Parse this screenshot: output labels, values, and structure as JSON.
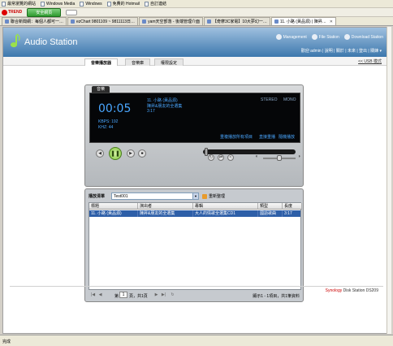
{
  "favorites": [
    {
      "label": "最常瀏覽的網站"
    },
    {
      "label": "Windows Media"
    },
    {
      "label": "Windows"
    },
    {
      "label": "免費的 Hotmail"
    },
    {
      "label": "自訂連結"
    }
  ],
  "trend": {
    "logo": "TREND",
    "safe_label": "安全網頁"
  },
  "tabs": [
    {
      "label": "聯合新聞網：每個人都可一…",
      "active": false
    },
    {
      "label": "ezChart 9801109 ~ 9811113日…",
      "active": false
    },
    {
      "label": "yam天空部落 - 後端管理介面",
      "active": false
    },
    {
      "label": "【奇摩3C家電】10大夢幻一…",
      "active": false
    },
    {
      "label": "11. 小路 (黃品源) | 陳昇…",
      "active": true
    }
  ],
  "status_bar": "完成",
  "header": {
    "title": "Audio Station",
    "links": {
      "management": "Management",
      "file_station": "File Station",
      "download_station": "Download Station"
    }
  },
  "subnav": {
    "tabs": [
      "音樂播放器",
      "音樂庫",
      "權限設定"
    ],
    "user_line": "歡迎 admin | 說明 | 關於 | 未來 | 登出 | 關練 ▾",
    "usb_link": "<< USB 模式"
  },
  "player": {
    "tab_label": "音樂",
    "time": "00:05",
    "kbps": "KBPS: 192",
    "khz": "KHZ: 44",
    "track_title": "11. 小路 (黃品源)",
    "track_album": "陳昇&朋友的全選集",
    "track_duration": "3:17",
    "stereo": "STEREO",
    "mono": "MONO",
    "repeat_all": "重複播放所有項目",
    "repeat_one": "直接重播",
    "shuffle": "隨機播放",
    "progress": 0.02,
    "volume": 0.5
  },
  "playlist": {
    "label": "播放清單",
    "selected": "Test001",
    "manage_label": "重新整理",
    "columns": [
      "標題",
      "演出者",
      "專輯",
      "類型",
      "長度"
    ],
    "rows": [
      {
        "title": "11. 小路 (黃品源)",
        "artist": "陳昇&朋友的全選集",
        "album": "大人的情歌全選集CD1",
        "genre": "國語歌曲",
        "length": "3:17"
      }
    ],
    "pager": {
      "page_label": "第",
      "page_value": "1",
      "of_label": "頁，共1頁",
      "summary": "顯示1 - 1項目，共1筆資料"
    }
  },
  "footer": {
    "brand": "Synology",
    "product": "Disk Station DS209"
  }
}
